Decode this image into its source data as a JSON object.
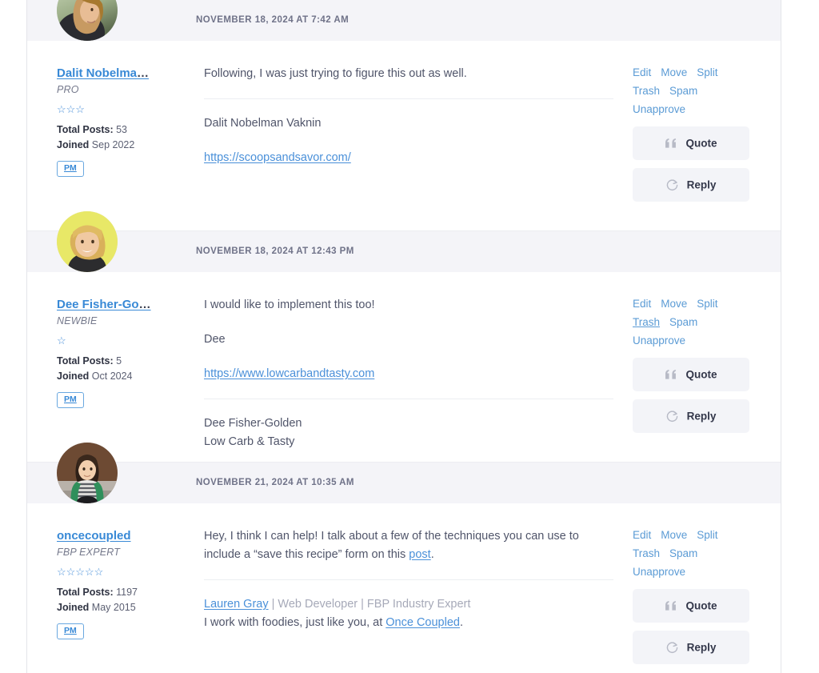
{
  "theme": {
    "link_blue": "#3889d6",
    "action_blue": "#5b9bd5",
    "band_bg": "#f4f4f8",
    "button_bg": "#f3f4f8",
    "body_text": "#50556a",
    "muted_text": "#83879a"
  },
  "actions": {
    "edit": "Edit",
    "move": "Move",
    "split": "Split",
    "trash": "Trash",
    "spam": "Spam",
    "unapprove": "Unapprove",
    "quote": "Quote",
    "reply": "Reply",
    "quote_icon": "quote-mark-icon",
    "reply_icon": "reply-arrow-icon"
  },
  "labels": {
    "total_posts": "Total Posts:",
    "joined": "Joined",
    "pm": "PM",
    "ellipsis": "…"
  },
  "posts": [
    {
      "id": "post-1",
      "date": "NOVEMBER 18, 2024 AT 7:42 AM",
      "author": {
        "name": "Dalit Nobelma",
        "name_truncated": true,
        "rank": "PRO",
        "stars": 3,
        "total_posts": "53",
        "joined": "Sep 2022",
        "avatar": "avatar-dalit"
      },
      "body": [
        {
          "type": "text",
          "value": "Following, I was just trying to figure this out as well."
        }
      ],
      "signature": [
        {
          "type": "text",
          "value": "Dalit Nobelman Vaknin"
        },
        {
          "type": "link",
          "value": "https://scoopsandsavor.com/"
        }
      ],
      "hovered_action": null
    },
    {
      "id": "post-2",
      "date": "NOVEMBER 18, 2024 AT 12:43 PM",
      "author": {
        "name": "Dee Fisher-Go",
        "name_truncated": true,
        "rank": "NEWBIE",
        "stars": 1,
        "total_posts": "5",
        "joined": "Oct 2024",
        "avatar": "avatar-dee"
      },
      "body": [
        {
          "type": "text",
          "value": "I would like to implement this too!"
        },
        {
          "type": "text",
          "value": "Dee"
        },
        {
          "type": "link",
          "value": "https://www.lowcarbandtasty.com"
        }
      ],
      "signature": [
        {
          "type": "text",
          "value": "Dee Fisher-Golden"
        },
        {
          "type": "text",
          "value": "Low Carb & Tasty"
        }
      ],
      "hovered_action": "trash"
    },
    {
      "id": "post-3",
      "date": "NOVEMBER 21, 2024 AT 10:35 AM",
      "author": {
        "name": "oncecoupled",
        "name_truncated": false,
        "rank": "FBP EXPERT",
        "stars": 5,
        "total_posts": "1197",
        "joined": "May 2015",
        "avatar": "avatar-oncecoupled"
      },
      "body": [
        {
          "type": "rich",
          "before": "Hey, I think I can help! I talk about a few of the techniques you can use to include a “save this recipe” form on this ",
          "link": "post",
          "after": "."
        }
      ],
      "signature_rich": {
        "line1_link": "Lauren Gray",
        "line1_rest": " | Web Developer | FBP Industry Expert",
        "line2_before": "I work with foodies, just like you, at ",
        "line2_link": "Once Coupled",
        "line2_after": "."
      },
      "hovered_action": null
    }
  ]
}
